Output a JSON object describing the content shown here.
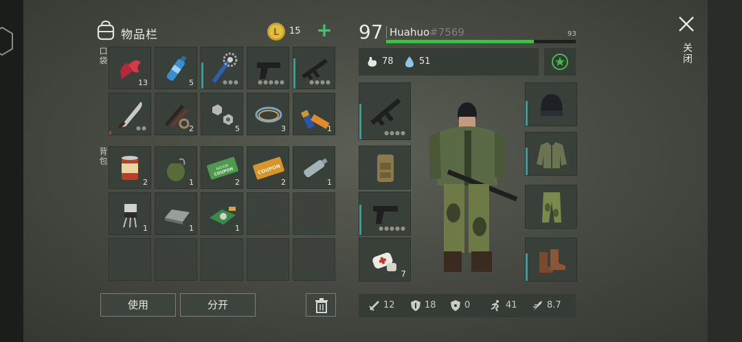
{
  "header": {
    "inventory_title": "物品栏",
    "coins": "15",
    "add_label": "+"
  },
  "sections": {
    "pockets": "口袋",
    "backpack": "背包"
  },
  "pocket_slots": [
    {
      "item": "raw-meat",
      "qty": "13"
    },
    {
      "item": "water-bottle",
      "qty": "5"
    },
    {
      "item": "spiked-club",
      "qty": "",
      "durability": 0.6
    },
    {
      "item": "pistol",
      "qty": ""
    },
    {
      "item": "assault-rifle",
      "qty": "",
      "durability": 0.7
    },
    {
      "item": "machete",
      "qty": "",
      "durability": 0.1
    },
    {
      "item": "parts",
      "qty": "2"
    },
    {
      "item": "nuts-bolts",
      "qty": "5"
    },
    {
      "item": "wire",
      "qty": "3"
    },
    {
      "item": "batteries",
      "qty": "1"
    }
  ],
  "backpack_slots": [
    {
      "item": "canned-food",
      "qty": "2"
    },
    {
      "item": "grenade",
      "qty": "1"
    },
    {
      "item": "ration-coupon",
      "qty": "2",
      "text": "RATION COUPON"
    },
    {
      "item": "coupon",
      "qty": "2",
      "text": "COUPON"
    },
    {
      "item": "empty-bottle",
      "qty": "1"
    },
    {
      "item": "transistor",
      "qty": "1"
    },
    {
      "item": "metal-bar",
      "qty": "1"
    },
    {
      "item": "circuit-board",
      "qty": "1"
    }
  ],
  "buttons": {
    "use": "使用",
    "split": "分开"
  },
  "player": {
    "level": "97",
    "name": "Huahuo",
    "tag": "#7569",
    "xp_max": "93",
    "xp_progress": 0.78,
    "food": "78",
    "water": "51"
  },
  "equipment": {
    "left": [
      {
        "item": "assault-rifle",
        "qty": ""
      },
      {
        "item": "tactical-backpack",
        "qty": ""
      },
      {
        "item": "pistol",
        "qty": ""
      },
      {
        "item": "bandages",
        "qty": "7"
      }
    ],
    "right": [
      {
        "item": "beanie",
        "qty": ""
      },
      {
        "item": "jacket",
        "qty": ""
      },
      {
        "item": "camo-pants",
        "qty": ""
      },
      {
        "item": "boots",
        "qty": ""
      }
    ]
  },
  "stats": [
    {
      "icon": "melee-icon",
      "value": "12"
    },
    {
      "icon": "armor-icon",
      "value": "18"
    },
    {
      "icon": "radiation-icon",
      "value": "0"
    },
    {
      "icon": "speed-icon",
      "value": "41"
    },
    {
      "icon": "stealth-icon",
      "value": "8.7"
    }
  ],
  "close_label": "关闭",
  "colors": {
    "accent_green": "#3fbf4a",
    "durability_teal": "#2aa6a0",
    "durability_red": "#c0392b"
  }
}
